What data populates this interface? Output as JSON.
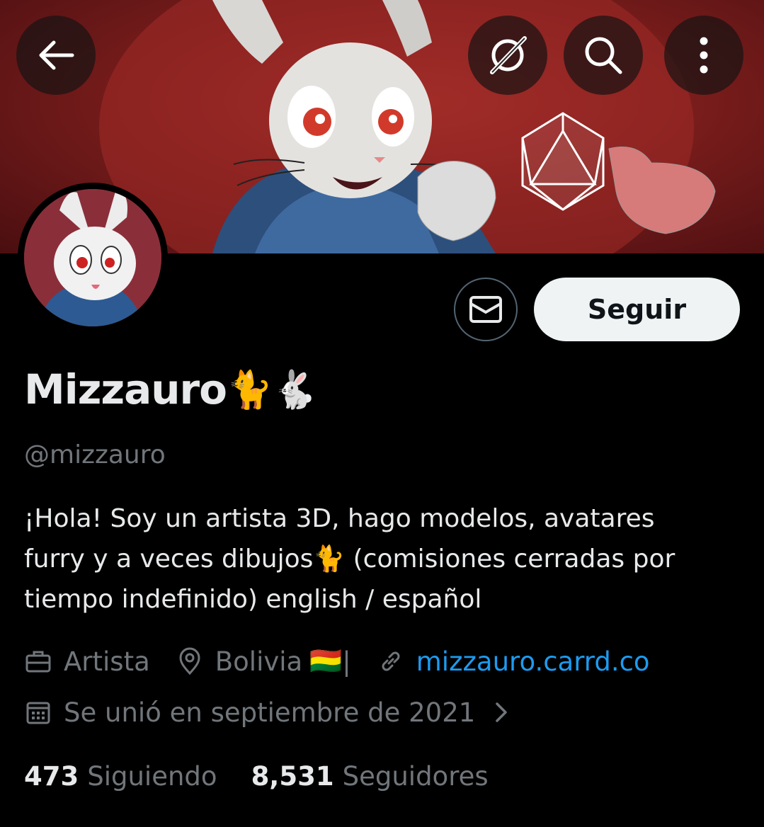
{
  "header": {
    "back_icon": "arrow-left-icon",
    "grok_icon": "grok-icon",
    "search_icon": "search-icon",
    "more_icon": "more-vertical-icon"
  },
  "profile": {
    "display_name": "Mizzauro",
    "name_emojis": [
      "🐈",
      "🐇"
    ],
    "handle": "@mizzauro",
    "bio_line1": "¡Hola! Soy un artista 3D, hago modelos, avatares",
    "bio_line2_a": "furry y a veces dibujos",
    "bio_line2_emoji": "🐈",
    "bio_line2_b": " (comisiones cerradas por",
    "bio_line3": "tiempo indefinido) english / español",
    "category": "Artista",
    "location": "Bolivia",
    "location_flag": "🇧🇴",
    "location_suffix": "|",
    "website": "mizzauro.carrd.co",
    "joined": "Se unió en septiembre de 2021",
    "following_count": "473",
    "following_label": "Siguiendo",
    "followers_count": "8,531",
    "followers_label": "Seguidores"
  },
  "actions": {
    "message_icon": "envelope-icon",
    "follow_label": "Seguir"
  },
  "colors": {
    "background": "#000000",
    "text": "#e7e9ea",
    "muted": "#71767b",
    "link": "#1d9bf0",
    "follow_bg": "#eff3f4"
  }
}
